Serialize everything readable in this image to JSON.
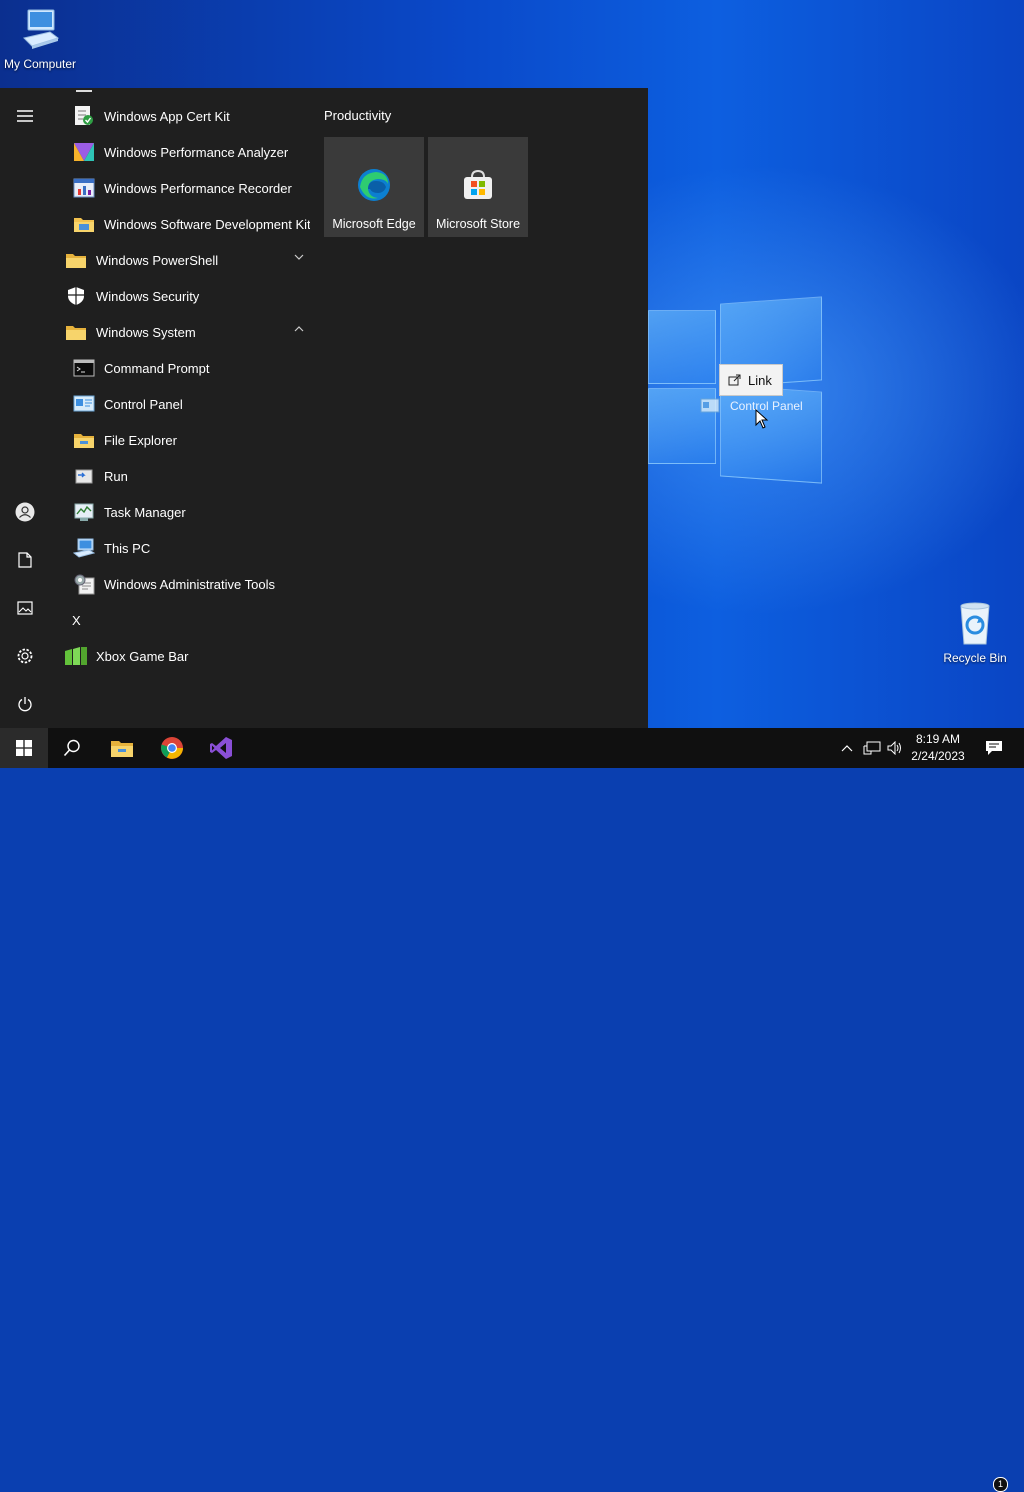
{
  "desktop": {
    "icons": [
      {
        "label": "My Computer"
      },
      {
        "label": "Recycle Bin"
      }
    ],
    "drag": {
      "tooltip": "Link",
      "item_label": "Control Panel"
    }
  },
  "start_menu": {
    "apps": [
      {
        "label": "Windows App Cert Kit",
        "icon": "cert-kit-icon"
      },
      {
        "label": "Windows Performance Analyzer",
        "icon": "performance-analyzer-icon"
      },
      {
        "label": "Windows Performance Recorder",
        "icon": "performance-recorder-icon"
      },
      {
        "label": "Windows Software Development Kit",
        "icon": "folder-icon"
      },
      {
        "label": "Windows PowerShell",
        "icon": "folder-icon",
        "state": "collapsed"
      },
      {
        "label": "Windows Security",
        "icon": "shield-icon"
      },
      {
        "label": "Windows System",
        "icon": "folder-icon",
        "state": "expanded"
      },
      {
        "label": "Command Prompt",
        "icon": "command-prompt-icon"
      },
      {
        "label": "Control Panel",
        "icon": "control-panel-icon"
      },
      {
        "label": "File Explorer",
        "icon": "file-explorer-icon"
      },
      {
        "label": "Run",
        "icon": "run-icon"
      },
      {
        "label": "Task Manager",
        "icon": "task-manager-icon"
      },
      {
        "label": "This PC",
        "icon": "this-pc-icon"
      },
      {
        "label": "Windows Administrative Tools",
        "icon": "admin-tools-icon"
      },
      {
        "label": "Xbox Game Bar",
        "icon": "xbox-game-bar-icon"
      }
    ],
    "letter_header": "X",
    "tile_group": {
      "title": "Productivity",
      "tiles": [
        {
          "label": "Microsoft Edge",
          "icon": "edge-icon"
        },
        {
          "label": "Microsoft Store",
          "icon": "store-icon"
        }
      ]
    },
    "rail_icons": [
      "hamburger-menu-icon",
      "user-icon",
      "documents-icon",
      "pictures-icon",
      "settings-icon",
      "power-icon"
    ]
  },
  "taskbar": {
    "pinned": [
      "windows-start-icon",
      "search-icon",
      "file-explorer-icon",
      "chrome-icon",
      "visual-studio-icon"
    ],
    "clock": {
      "time": "8:19 AM",
      "date": "2/24/2023"
    },
    "notification_count": "1"
  },
  "colors": {
    "start_menu_bg": "#1f1f1f",
    "tile_bg": "#3a3a3a",
    "taskbar_bg": "#101010",
    "visual_studio": "#8a4fd6",
    "folder": "#f2c14e"
  }
}
